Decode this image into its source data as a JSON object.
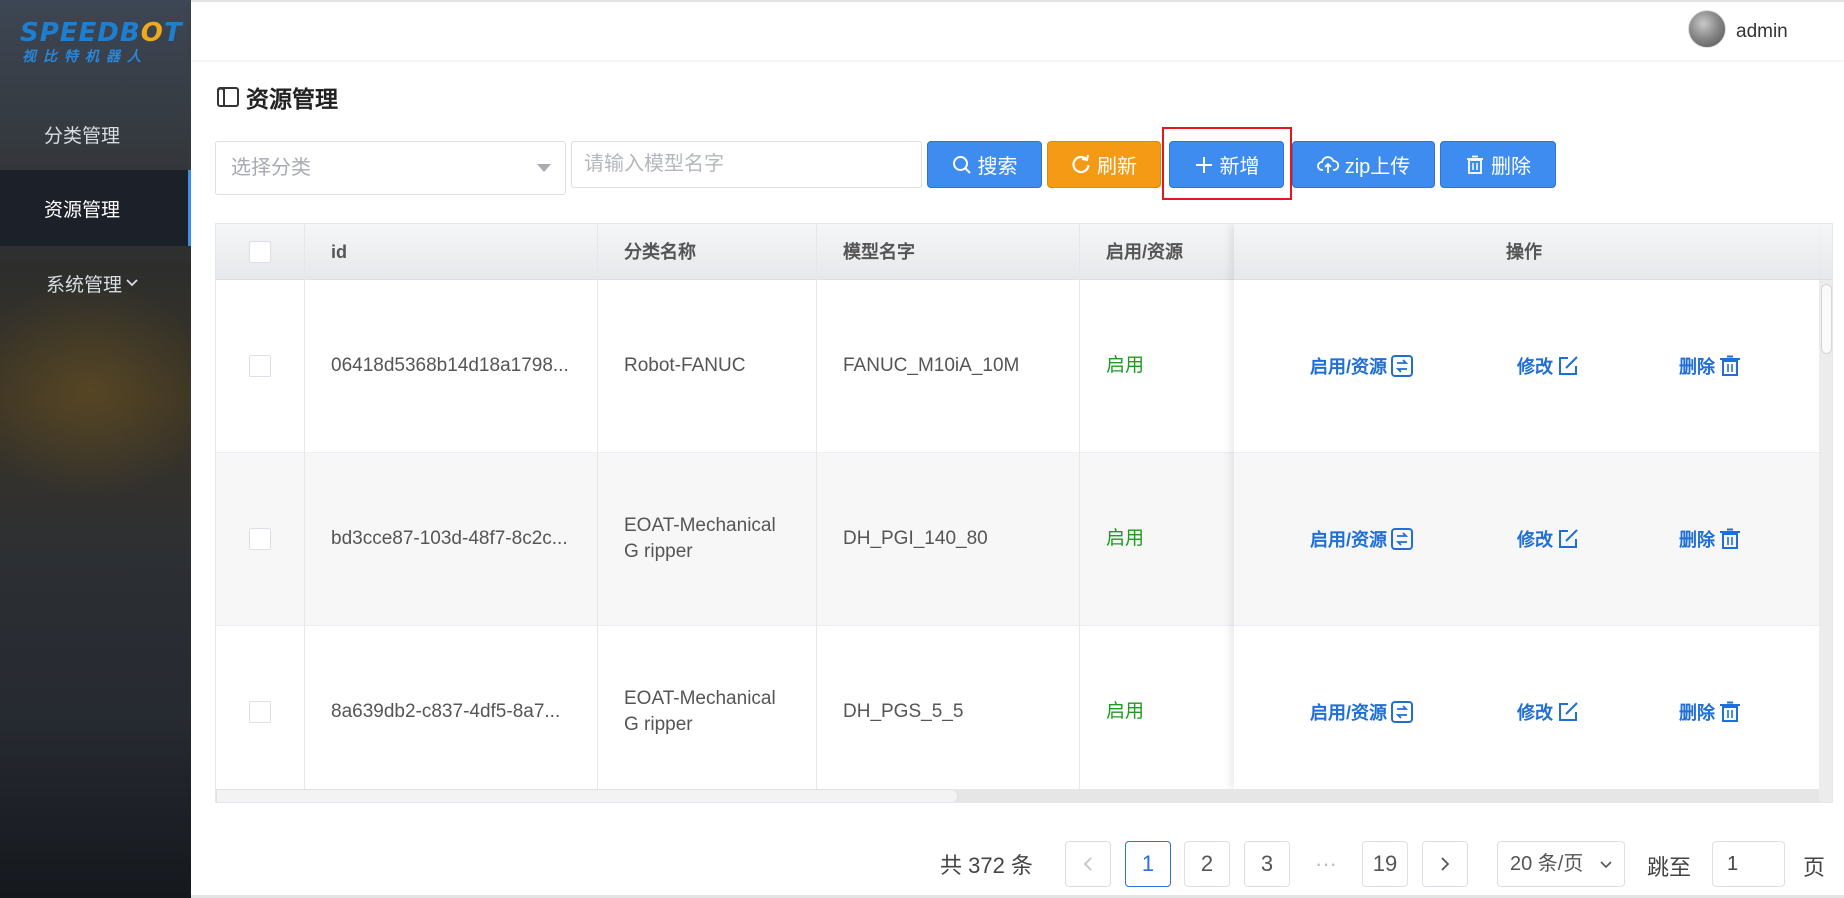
{
  "logo": {
    "top": "SPEEDBOT",
    "bottom": "视比特机器人"
  },
  "sidebar": {
    "items": [
      {
        "label": "分类管理",
        "active": false
      },
      {
        "label": "资源管理",
        "active": true
      },
      {
        "label": "系统管理",
        "active": false,
        "has_chevron": true
      }
    ]
  },
  "header": {
    "username": "admin"
  },
  "page": {
    "title": "资源管理"
  },
  "filters": {
    "category_placeholder": "选择分类",
    "model_placeholder": "请输入模型名字"
  },
  "toolbar": {
    "search_label": "搜索",
    "refresh_label": "刷新",
    "add_label": "新增",
    "zip_label": "zip上传",
    "delete_label": "删除",
    "colors": {
      "blue": "#3f8cf1",
      "orange": "#f59a14",
      "highlight": "#e6161f"
    }
  },
  "table": {
    "columns": [
      "id",
      "分类名称",
      "模型名字",
      "启用/资源",
      "操作"
    ],
    "rows": [
      {
        "id": "06418d5368b14d18a1798...",
        "category": "Robot-FANUC",
        "model": "FANUC_M10iA_10M",
        "status": "启用"
      },
      {
        "id": "bd3cce87-103d-48f7-8c2c...",
        "category": "EOAT-Mechanical G ripper",
        "model": "DH_PGI_140_80",
        "status": "启用"
      },
      {
        "id": "8a639db2-c837-4df5-8a7...",
        "category": "EOAT-Mechanical G ripper",
        "model": "DH_PGS_5_5",
        "status": "启用"
      }
    ],
    "actions": {
      "toggle": "启用/资源",
      "edit": "修改",
      "delete": "删除"
    },
    "status_color": "#1f9b1f"
  },
  "pagination": {
    "total_text": "共 372 条",
    "pages": [
      "1",
      "2",
      "3",
      "···",
      "19"
    ],
    "current": "1",
    "page_size": "20 条/页",
    "jump_label": "跳至",
    "jump_value": "1",
    "page_suffix": "页"
  }
}
